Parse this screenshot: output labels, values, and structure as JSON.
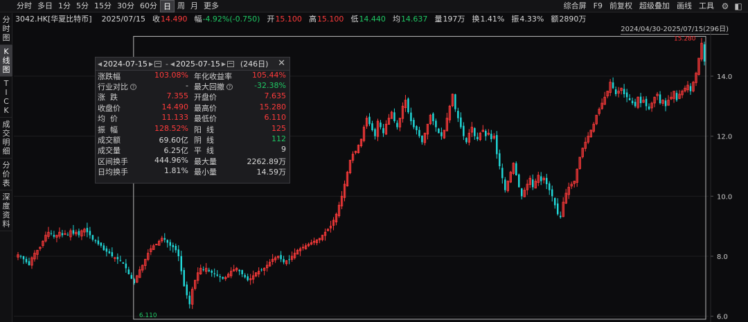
{
  "toolbar": {
    "periods": [
      "分时",
      "多日",
      "1分",
      "5分",
      "15分",
      "30分",
      "60分",
      "日",
      "周",
      "月",
      "更多"
    ],
    "active_period": "日",
    "right_items": [
      "综合屏",
      "F9",
      "前复权",
      "超级叠加",
      "画线",
      "工具"
    ],
    "icons": [
      "settings-icon",
      "wechat-icon"
    ]
  },
  "info": {
    "code": "3042.HK[华夏比特币]",
    "date": "2025/07/15",
    "close_label": "收",
    "close": "14.490",
    "chg_label": "幅",
    "chg": "-4.92%(-0.750)",
    "open_label": "开",
    "open": "15.100",
    "high_label": "高",
    "high": "15.100",
    "low_label": "低",
    "low": "14.440",
    "avg_label": "均",
    "avg": "14.637",
    "vol_label": "量",
    "vol": "197万",
    "turn_label": "换",
    "turn": "1.41%",
    "amp_label": "振",
    "amp": "4.33%",
    "amt_label": "额",
    "amt": "2890万"
  },
  "sidebar": {
    "tabs": [
      {
        "label": [
          "分",
          "时",
          "图"
        ],
        "active": false
      },
      {
        "label": [
          "K",
          "线",
          "图"
        ],
        "active": true
      },
      {
        "label": [
          "T",
          "I",
          "C",
          "K"
        ],
        "active": false
      },
      {
        "label": [
          "成",
          "交",
          "明",
          "细"
        ],
        "active": false
      },
      {
        "label": [
          "分",
          "价",
          "表"
        ],
        "active": false
      },
      {
        "label": [
          "深",
          "度",
          "资",
          "料"
        ],
        "active": false
      }
    ]
  },
  "range_label": "2024/04/30-2025/07/15(296日)",
  "panel": {
    "start_date": "2024-07-15",
    "end_date": "2025-07-15",
    "days": "(246日)",
    "rows": [
      {
        "l_label": "涨跌幅",
        "l_value": "103.08%",
        "l_color": "red",
        "r_label": "年化收益率",
        "r_value": "105.44%",
        "r_color": "red"
      },
      {
        "l_label": "行业对比",
        "l_help": true,
        "l_value": "-",
        "l_color": "white",
        "r_label": "最大回撤",
        "r_help": true,
        "r_value": "-32.38%",
        "r_color": "green"
      },
      {
        "l_label": "涨  跌",
        "l_value": "7.355",
        "l_color": "red",
        "r_label": "开盘价",
        "r_value": "7.635",
        "r_color": "red"
      },
      {
        "l_label": "收盘价",
        "l_value": "14.490",
        "l_color": "red",
        "r_label": "最高价",
        "r_value": "15.280",
        "r_color": "red"
      },
      {
        "l_label": "均  价",
        "l_value": "11.133",
        "l_color": "red",
        "r_label": "最低价",
        "r_value": "6.110",
        "r_color": "red"
      },
      {
        "l_label": "振  幅",
        "l_value": "128.52%",
        "l_color": "red",
        "r_label": "阳  线",
        "r_value": "125",
        "r_color": "red"
      },
      {
        "l_label": "成交额",
        "l_value": "69.60亿",
        "l_color": "white",
        "r_label": "阴  线",
        "r_value": "112",
        "r_color": "green"
      },
      {
        "l_label": "成交量",
        "l_value": "6.25亿",
        "l_color": "white",
        "r_label": "平  线",
        "r_value": "9",
        "r_color": "white"
      },
      {
        "l_label": "区间换手",
        "l_value": "444.96%",
        "l_color": "white",
        "r_label": "最大量",
        "r_value": "2262.89万",
        "r_color": "white"
      },
      {
        "l_label": "日均换手",
        "l_value": "1.81%",
        "l_color": "white",
        "r_label": "最小量",
        "r_value": "14.59万",
        "r_color": "white"
      }
    ]
  },
  "chart_data": {
    "type": "candlestick",
    "y_ticks": [
      "14.0",
      "12.0",
      "10.0",
      "8.0",
      "6.0"
    ],
    "ylim": [
      5.9,
      15.5
    ],
    "high_marker": "15.280",
    "low_marker": "6.110",
    "colors": {
      "up": "#ff3b3b",
      "down": "#21d8d8",
      "range_box": "#b9b9b9",
      "axis_text": "#c9c9c9",
      "grid": "#1e1e20"
    },
    "closes": [
      8.05,
      8.0,
      7.9,
      7.8,
      7.7,
      7.95,
      8.1,
      8.2,
      8.3,
      8.5,
      8.7,
      8.8,
      8.75,
      8.65,
      8.7,
      8.8,
      8.7,
      8.75,
      8.7,
      8.85,
      8.75,
      8.8,
      8.7,
      8.85,
      8.9,
      8.8,
      8.7,
      8.55,
      8.5,
      8.4,
      8.35,
      8.2,
      8.15,
      8.1,
      8.0,
      7.95,
      7.9,
      7.85,
      7.75,
      7.6,
      7.4,
      7.25,
      7.1,
      7.35,
      7.55,
      7.7,
      7.9,
      8.1,
      8.25,
      8.35,
      8.4,
      8.5,
      8.6,
      8.55,
      8.45,
      8.35,
      8.3,
      8.2,
      8.0,
      7.5,
      7.0,
      6.7,
      6.4,
      6.9,
      7.2,
      7.45,
      7.6,
      7.55,
      7.6,
      7.5,
      7.45,
      7.4,
      7.35,
      7.3,
      7.25,
      7.3,
      7.4,
      7.5,
      7.55,
      7.6,
      7.5,
      7.4,
      7.3,
      7.2,
      7.25,
      7.35,
      7.45,
      7.5,
      7.55,
      7.6,
      7.7,
      7.8,
      7.9,
      7.95,
      8.0,
      7.9,
      7.8,
      7.85,
      7.9,
      8.0,
      8.1,
      8.2,
      8.25,
      8.3,
      8.35,
      8.4,
      8.45,
      8.5,
      8.55,
      8.6,
      8.7,
      8.8,
      8.9,
      9.0,
      9.2,
      9.4,
      9.7,
      10.0,
      10.4,
      10.8,
      11.2,
      11.4,
      11.5,
      11.7,
      11.9,
      12.3,
      12.6,
      12.4,
      12.2,
      12.0,
      12.5,
      12.3,
      12.1,
      12.4,
      12.6,
      12.8,
      12.5,
      12.3,
      12.6,
      13.0,
      13.2,
      12.8,
      12.5,
      12.3,
      12.2,
      12.0,
      11.8,
      12.1,
      12.4,
      12.7,
      12.5,
      12.3,
      12.1,
      12.0,
      12.2,
      12.6,
      13.0,
      13.4,
      12.9,
      12.6,
      12.3,
      12.0,
      11.8,
      12.1,
      12.3,
      12.0,
      11.9,
      12.1,
      12.2,
      12.0,
      12.1,
      11.9,
      12.0,
      11.4,
      11.0,
      10.6,
      10.2,
      10.5,
      10.8,
      11.1,
      10.7,
      10.3,
      10.0,
      10.2,
      10.4,
      10.6,
      10.3,
      10.5,
      10.7,
      10.5,
      10.6,
      10.4,
      10.2,
      10.0,
      9.7,
      9.4,
      9.3,
      9.8,
      10.1,
      10.3,
      10.4,
      10.5,
      10.9,
      11.3,
      11.6,
      11.8,
      12.0,
      12.2,
      12.4,
      12.7,
      12.9,
      13.1,
      13.3,
      13.5,
      13.8,
      13.6,
      13.4,
      13.5,
      13.6,
      13.4,
      13.3,
      13.2,
      13.1,
      13.0,
      13.3,
      13.1,
      13.2,
      13.0,
      12.9,
      13.1,
      13.3,
      13.4,
      13.1,
      13.2,
      13.0,
      13.2,
      13.3,
      13.5,
      13.2,
      13.4,
      13.5,
      13.6,
      13.7,
      13.5,
      13.8,
      14.1,
      14.6,
      15.1,
      14.49
    ]
  }
}
